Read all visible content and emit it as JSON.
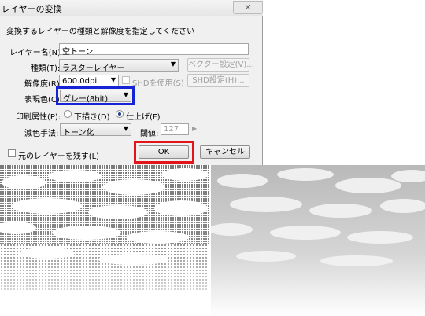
{
  "dialog": {
    "title": "レイヤーの変換",
    "close_glyph": "✕",
    "instruction": "変換するレイヤーの種類と解像度を指定してください",
    "layer_name_label": "レイヤー名(N):",
    "layer_name_value": "空トーン",
    "type_label": "種類(T):",
    "type_value": "ラスターレイヤー",
    "vector_settings_button": "ベクター設定(V)...",
    "resolution_label": "解像度(R):",
    "resolution_value": "600.0dpi",
    "shd_checkbox_label": "SHDを使用(S)",
    "shd_settings_button": "SHD設定(H)...",
    "color_label": "表現色(C):",
    "color_value": "グレー(8bit)",
    "print_attr_label": "印刷属性(P):",
    "print_attr_draft": "下描き(D)",
    "print_attr_final": "仕上げ(F)",
    "print_attr_selected": "仕上げ(F)",
    "reduction_label": "減色手法:",
    "reduction_value": "トーン化",
    "threshold_label": "閾値:",
    "threshold_value": "127",
    "keep_original_label": "元のレイヤーを残す(L)",
    "ok_button": "OK",
    "cancel_button": "キャンセル"
  },
  "colors": {
    "blue_highlight": "#1524d4",
    "red_highlight": "#e1151a"
  },
  "icons": [
    "close-icon",
    "dropdown-arrow-icon",
    "spin-arrow-icon"
  ]
}
